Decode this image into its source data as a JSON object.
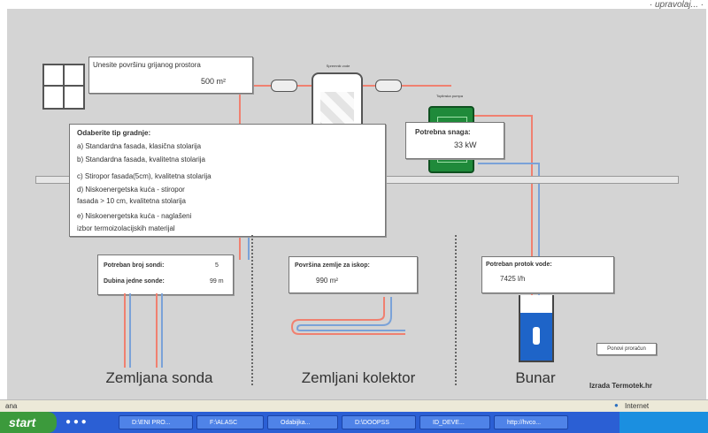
{
  "area_box": {
    "label": "Unesite površinu grijanog prostora",
    "value": "500  m²"
  },
  "storage_tank": {
    "label": "Spremnik vode"
  },
  "heat_pump": {
    "label": "Toplinska pumpa"
  },
  "power_box": {
    "label": "Potrebna snaga:",
    "value": "33  kW"
  },
  "building_type": {
    "title": "Odaberite tip gradnje:",
    "options": [
      "a) Standardna fasada, klasična stolarija",
      "b) Standardna fasada, kvalitetna stolarija",
      "c) Stiropor fasada(5cm), kvalitetna stolarija",
      "d) Niskoenergetska kuća - stiropor",
      "fasada > 10 cm, kvalitetna stolarija",
      "e) Niskoenergetska kuća - naglašeni",
      "izbor termoizolacijskih materijal"
    ]
  },
  "probes_box": {
    "count_label": "Potreban broj sondi:",
    "count_value": "5",
    "depth_label": "Dubina jedne sonde:",
    "depth_value": "99 m"
  },
  "collector_box": {
    "label": "Površina zemlje za iskop:",
    "value": "990  m²"
  },
  "water_box": {
    "label": "Potreban protok vode:",
    "value": "7425  l/h"
  },
  "recalc_button": "Ponovi proračun",
  "sections": {
    "probe": "Zemljana sonda",
    "collector": "Zemljani kolektor",
    "well": "Bunar"
  },
  "credit": "Izrada Termotek.hr",
  "status": {
    "left": "ana",
    "zone": "Internet"
  },
  "taskbar": {
    "start": "start",
    "buttons": [
      "D:\\ENI PRO...",
      "F:\\ALASC",
      "Odabijka...",
      "D:\\DOOPSS",
      "ID_DEVE...",
      "http://hvco..."
    ]
  },
  "colors": {
    "canvas": "#d4d4d4",
    "pipe_hot": "#f08070",
    "pipe_cold": "#7aa2d8",
    "pump_green": "#1f8a3a",
    "taskbar": "#2b5fd4"
  }
}
